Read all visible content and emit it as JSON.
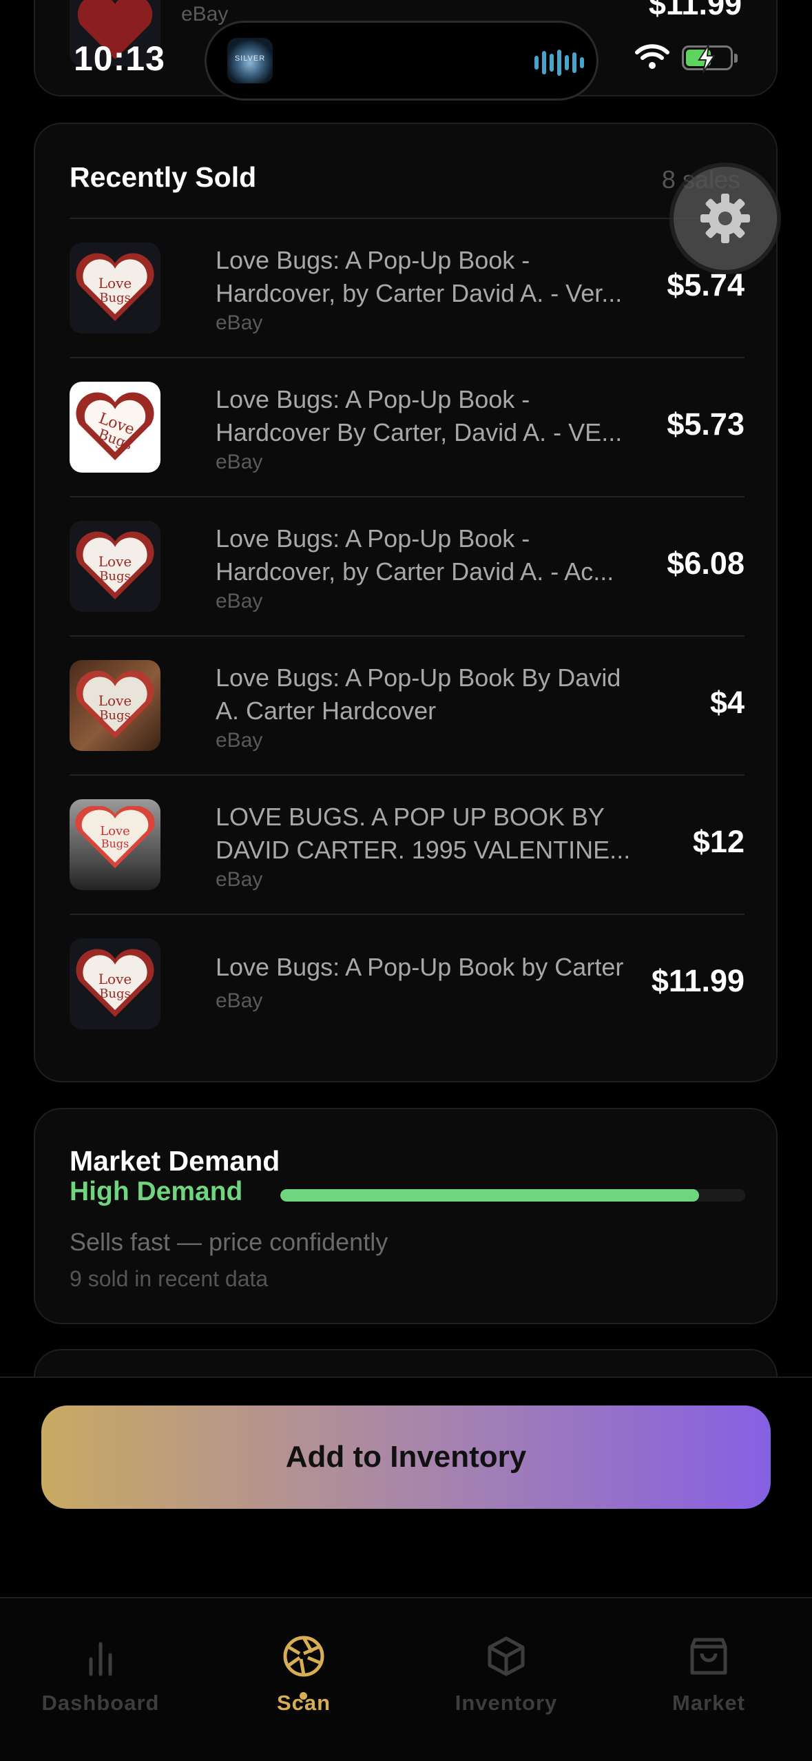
{
  "status_bar": {
    "time": "10:13",
    "island_art_text": "SILVER"
  },
  "top_partial": {
    "source": "eBay",
    "price": "$11.99"
  },
  "recently_sold": {
    "title": "Recently Sold",
    "count": "8 sales",
    "items": [
      {
        "line1": "Love Bugs: A Pop-Up Book -",
        "line2": "Hardcover, by Carter David A. - Ver...",
        "source": "eBay",
        "price": "$5.74"
      },
      {
        "line1": "Love Bugs: A Pop-Up Book -",
        "line2": "Hardcover By Carter, David A. - VE...",
        "source": "eBay",
        "price": "$5.73"
      },
      {
        "line1": "Love Bugs: A Pop-Up Book -",
        "line2": "Hardcover, by Carter David A. - Ac...",
        "source": "eBay",
        "price": "$6.08"
      },
      {
        "line1": "Love Bugs: A Pop-Up Book By David",
        "line2": "A. Carter Hardcover",
        "source": "eBay",
        "price": "$4"
      },
      {
        "line1": "LOVE BUGS. A POP UP BOOK BY",
        "line2": "DAVID CARTER. 1995 VALENTINE...",
        "source": "eBay",
        "price": "$12"
      },
      {
        "line1": "Love Bugs: A Pop-Up Book by Carter",
        "line2": "",
        "source": "eBay",
        "price": "$11.99"
      }
    ]
  },
  "market_demand": {
    "title": "Market Demand",
    "level": "High Demand",
    "level_fraction": 0.9,
    "subtitle": "Sells fast — price confidently",
    "sold_count": "9 sold in recent data",
    "color": "#6fd67f"
  },
  "cta": {
    "label": "Add to Inventory"
  },
  "tabs": [
    {
      "label": "Dashboard",
      "icon": "bar-chart-icon",
      "active": false
    },
    {
      "label": "Scan",
      "icon": "aperture-icon",
      "active": true
    },
    {
      "label": "Inventory",
      "icon": "box-icon",
      "active": false
    },
    {
      "label": "Market",
      "icon": "shopping-bag-icon",
      "active": false
    }
  ],
  "colors": {
    "accent": "#d8ae55",
    "inactive_tab": "#3d3d3d",
    "gradient_start": "#c9aa62",
    "gradient_end": "#8660e3"
  }
}
